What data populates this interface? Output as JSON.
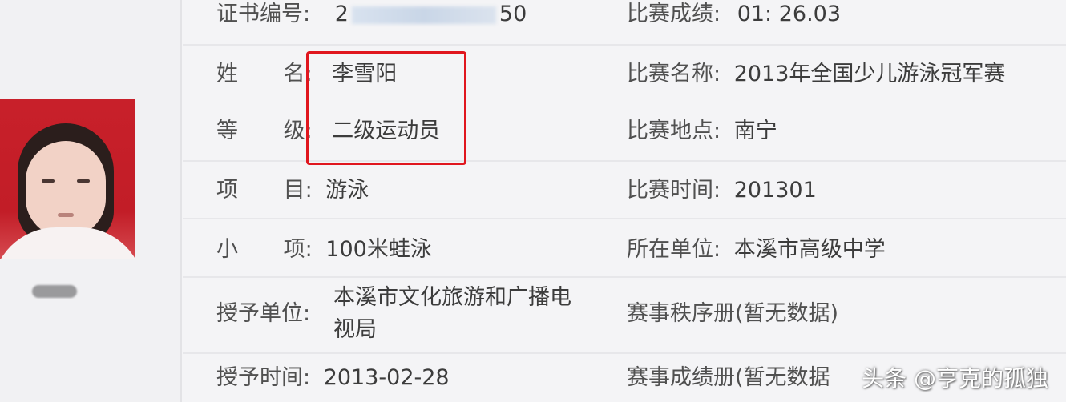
{
  "left": {
    "certificate_no_label": "证书编号:",
    "certificate_no_prefix": "2",
    "certificate_no_suffix": "50",
    "name_label_1": "姓",
    "name_label_2": "名:",
    "name_value": "李雪阳",
    "grade_label_1": "等",
    "grade_label_2": "级:",
    "grade_value": "二级运动员",
    "event_label_1": "项",
    "event_label_2": "目:",
    "event_value": "游泳",
    "subevent_label_1": "小",
    "subevent_label_2": "项:",
    "subevent_value": "100米蛙泳",
    "issuer_label": "授予单位:",
    "issuer_value_line1": "本溪市文化旅游和广播电",
    "issuer_value_line2": "视局",
    "issue_time_label": "授予时间:",
    "issue_time_value": "2013-02-28"
  },
  "right": {
    "result_label": "比赛成绩:",
    "result_value": "01: 26.03",
    "competition_label": "比赛名称:",
    "competition_value": "2013年全国少儿游泳冠军赛",
    "venue_label": "比赛地点:",
    "venue_value": "南宁",
    "date_label": "比赛时间:",
    "date_value": "201301",
    "unit_label": "所在单位:",
    "unit_value": "本溪市高级中学",
    "order_book": "赛事秩序册(暂无数据)",
    "result_book": "赛事成绩册(暂无数据"
  },
  "watermark": "头条 @亨克的孤独",
  "colors": {
    "highlight": "#e0161e",
    "photo_background": "#c8202a"
  }
}
